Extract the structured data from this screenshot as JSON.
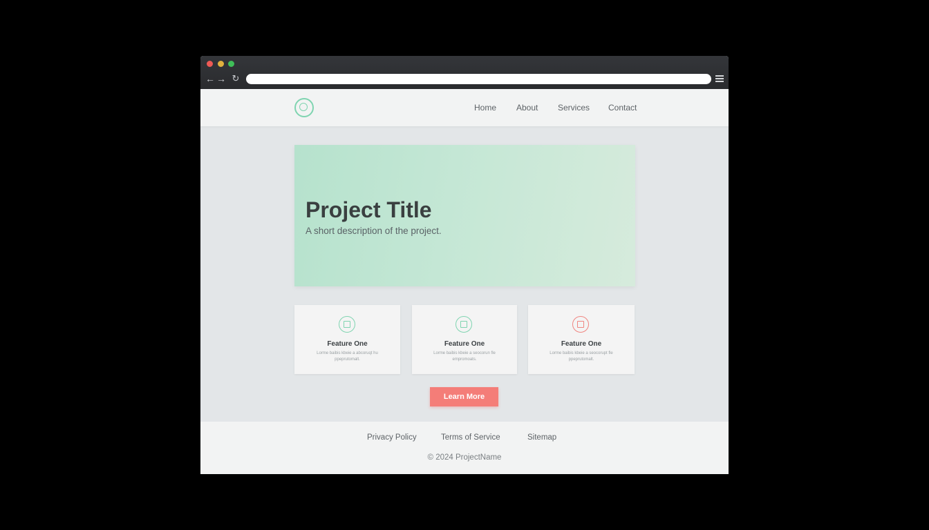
{
  "browser": {
    "url": "",
    "back_icon": "arrow-left-icon",
    "forward_icon": "arrow-right-icon",
    "reload_icon": "reload-icon",
    "menu_icon": "hamburger-menu-icon"
  },
  "header": {
    "logo_icon": "concentric-circle-logo",
    "nav": [
      "Home",
      "About",
      "Services",
      "Contact"
    ]
  },
  "hero": {
    "title": "Project Title",
    "subtitle": "A short description of the project."
  },
  "features": [
    {
      "title": "Feature One",
      "text": "Lorme baibis kbeie a abcoruqt hu ppeprutomalt.",
      "icon": "grid-icon",
      "color": "#7fd4b0"
    },
    {
      "title": "Feature One",
      "text": "Lorme baibis kbeie a seocorun fle empromoats.",
      "icon": "grid-icon",
      "color": "#7fd4b0"
    },
    {
      "title": "Feature One",
      "text": "Lorme baibis kbeie a seocorupt fle ppeprutomalt.",
      "icon": "image-icon",
      "color": "#f0847f"
    }
  ],
  "cta": {
    "label": "Learn More",
    "color": "#f47d78"
  },
  "footer": {
    "links": [
      "Privacy Policy",
      "Terms of Service",
      "Sitemap"
    ],
    "copyright": "© 2024 ProjectName"
  },
  "colors": {
    "accent": "#7fd4b0",
    "cta": "#f47d78"
  }
}
